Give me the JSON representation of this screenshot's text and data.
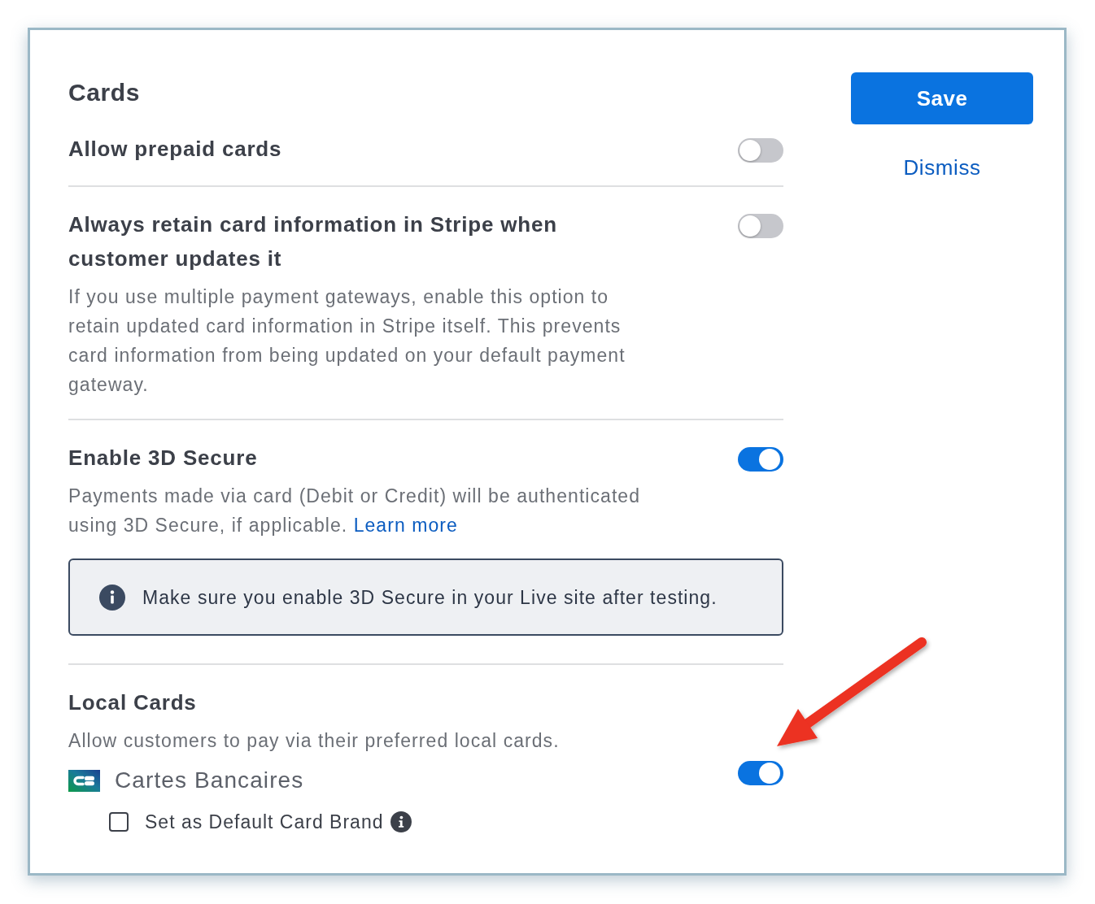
{
  "heading": "Cards",
  "actions": {
    "save": "Save",
    "dismiss": "Dismiss"
  },
  "settings": [
    {
      "kind": "toggle",
      "title": "Allow prepaid cards",
      "on": false
    },
    {
      "kind": "toggle",
      "title": "Always retain card information in Stripe when customer updates it",
      "on": false,
      "description": "If you use multiple payment gateways, enable this option to retain updated card information in Stripe itself. This prevents card information from being updated on your default payment gateway."
    },
    {
      "kind": "toggle",
      "title": "Enable 3D Secure",
      "on": true,
      "description": "Payments made via card (Debit or Credit) will be authenticated using 3D Secure, if applicable.",
      "link": "Learn more",
      "notice": "Make sure you enable 3D Secure in your Live site after testing."
    },
    {
      "kind": "local_cards",
      "title": "Local Cards",
      "description": "Allow customers to pay via their preferred local cards.",
      "cards": [
        {
          "name": "Cartes Bancaires",
          "on": true,
          "default_option": {
            "label": "Set as Default Card Brand",
            "checked": false
          }
        }
      ]
    }
  ],
  "annotations": [
    {
      "kind": "arrow"
    }
  ]
}
